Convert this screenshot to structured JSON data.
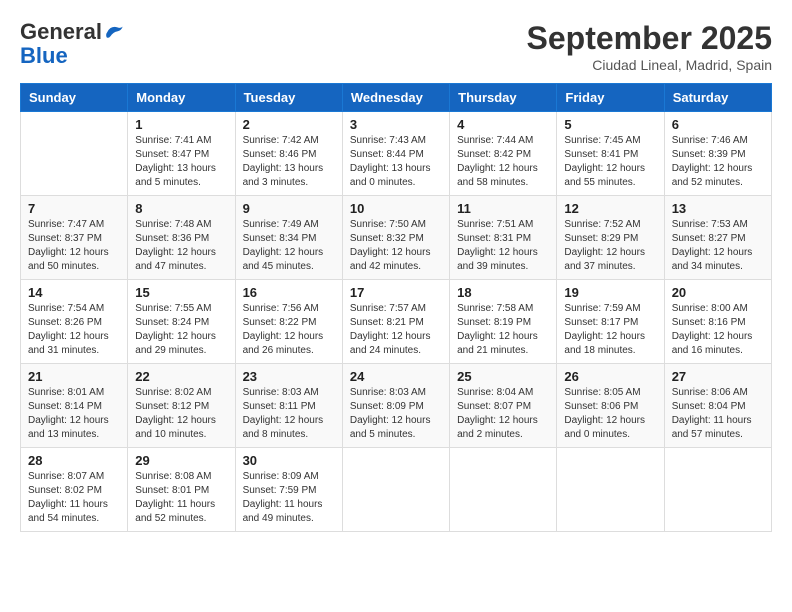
{
  "header": {
    "logo_line1": "General",
    "logo_line2": "Blue",
    "month": "September 2025",
    "location": "Ciudad Lineal, Madrid, Spain"
  },
  "days_of_week": [
    "Sunday",
    "Monday",
    "Tuesday",
    "Wednesday",
    "Thursday",
    "Friday",
    "Saturday"
  ],
  "weeks": [
    [
      {
        "num": "",
        "detail": ""
      },
      {
        "num": "1",
        "detail": "Sunrise: 7:41 AM\nSunset: 8:47 PM\nDaylight: 13 hours\nand 5 minutes."
      },
      {
        "num": "2",
        "detail": "Sunrise: 7:42 AM\nSunset: 8:46 PM\nDaylight: 13 hours\nand 3 minutes."
      },
      {
        "num": "3",
        "detail": "Sunrise: 7:43 AM\nSunset: 8:44 PM\nDaylight: 13 hours\nand 0 minutes."
      },
      {
        "num": "4",
        "detail": "Sunrise: 7:44 AM\nSunset: 8:42 PM\nDaylight: 12 hours\nand 58 minutes."
      },
      {
        "num": "5",
        "detail": "Sunrise: 7:45 AM\nSunset: 8:41 PM\nDaylight: 12 hours\nand 55 minutes."
      },
      {
        "num": "6",
        "detail": "Sunrise: 7:46 AM\nSunset: 8:39 PM\nDaylight: 12 hours\nand 52 minutes."
      }
    ],
    [
      {
        "num": "7",
        "detail": "Sunrise: 7:47 AM\nSunset: 8:37 PM\nDaylight: 12 hours\nand 50 minutes."
      },
      {
        "num": "8",
        "detail": "Sunrise: 7:48 AM\nSunset: 8:36 PM\nDaylight: 12 hours\nand 47 minutes."
      },
      {
        "num": "9",
        "detail": "Sunrise: 7:49 AM\nSunset: 8:34 PM\nDaylight: 12 hours\nand 45 minutes."
      },
      {
        "num": "10",
        "detail": "Sunrise: 7:50 AM\nSunset: 8:32 PM\nDaylight: 12 hours\nand 42 minutes."
      },
      {
        "num": "11",
        "detail": "Sunrise: 7:51 AM\nSunset: 8:31 PM\nDaylight: 12 hours\nand 39 minutes."
      },
      {
        "num": "12",
        "detail": "Sunrise: 7:52 AM\nSunset: 8:29 PM\nDaylight: 12 hours\nand 37 minutes."
      },
      {
        "num": "13",
        "detail": "Sunrise: 7:53 AM\nSunset: 8:27 PM\nDaylight: 12 hours\nand 34 minutes."
      }
    ],
    [
      {
        "num": "14",
        "detail": "Sunrise: 7:54 AM\nSunset: 8:26 PM\nDaylight: 12 hours\nand 31 minutes."
      },
      {
        "num": "15",
        "detail": "Sunrise: 7:55 AM\nSunset: 8:24 PM\nDaylight: 12 hours\nand 29 minutes."
      },
      {
        "num": "16",
        "detail": "Sunrise: 7:56 AM\nSunset: 8:22 PM\nDaylight: 12 hours\nand 26 minutes."
      },
      {
        "num": "17",
        "detail": "Sunrise: 7:57 AM\nSunset: 8:21 PM\nDaylight: 12 hours\nand 24 minutes."
      },
      {
        "num": "18",
        "detail": "Sunrise: 7:58 AM\nSunset: 8:19 PM\nDaylight: 12 hours\nand 21 minutes."
      },
      {
        "num": "19",
        "detail": "Sunrise: 7:59 AM\nSunset: 8:17 PM\nDaylight: 12 hours\nand 18 minutes."
      },
      {
        "num": "20",
        "detail": "Sunrise: 8:00 AM\nSunset: 8:16 PM\nDaylight: 12 hours\nand 16 minutes."
      }
    ],
    [
      {
        "num": "21",
        "detail": "Sunrise: 8:01 AM\nSunset: 8:14 PM\nDaylight: 12 hours\nand 13 minutes."
      },
      {
        "num": "22",
        "detail": "Sunrise: 8:02 AM\nSunset: 8:12 PM\nDaylight: 12 hours\nand 10 minutes."
      },
      {
        "num": "23",
        "detail": "Sunrise: 8:03 AM\nSunset: 8:11 PM\nDaylight: 12 hours\nand 8 minutes."
      },
      {
        "num": "24",
        "detail": "Sunrise: 8:03 AM\nSunset: 8:09 PM\nDaylight: 12 hours\nand 5 minutes."
      },
      {
        "num": "25",
        "detail": "Sunrise: 8:04 AM\nSunset: 8:07 PM\nDaylight: 12 hours\nand 2 minutes."
      },
      {
        "num": "26",
        "detail": "Sunrise: 8:05 AM\nSunset: 8:06 PM\nDaylight: 12 hours\nand 0 minutes."
      },
      {
        "num": "27",
        "detail": "Sunrise: 8:06 AM\nSunset: 8:04 PM\nDaylight: 11 hours\nand 57 minutes."
      }
    ],
    [
      {
        "num": "28",
        "detail": "Sunrise: 8:07 AM\nSunset: 8:02 PM\nDaylight: 11 hours\nand 54 minutes."
      },
      {
        "num": "29",
        "detail": "Sunrise: 8:08 AM\nSunset: 8:01 PM\nDaylight: 11 hours\nand 52 minutes."
      },
      {
        "num": "30",
        "detail": "Sunrise: 8:09 AM\nSunset: 7:59 PM\nDaylight: 11 hours\nand 49 minutes."
      },
      {
        "num": "",
        "detail": ""
      },
      {
        "num": "",
        "detail": ""
      },
      {
        "num": "",
        "detail": ""
      },
      {
        "num": "",
        "detail": ""
      }
    ]
  ]
}
